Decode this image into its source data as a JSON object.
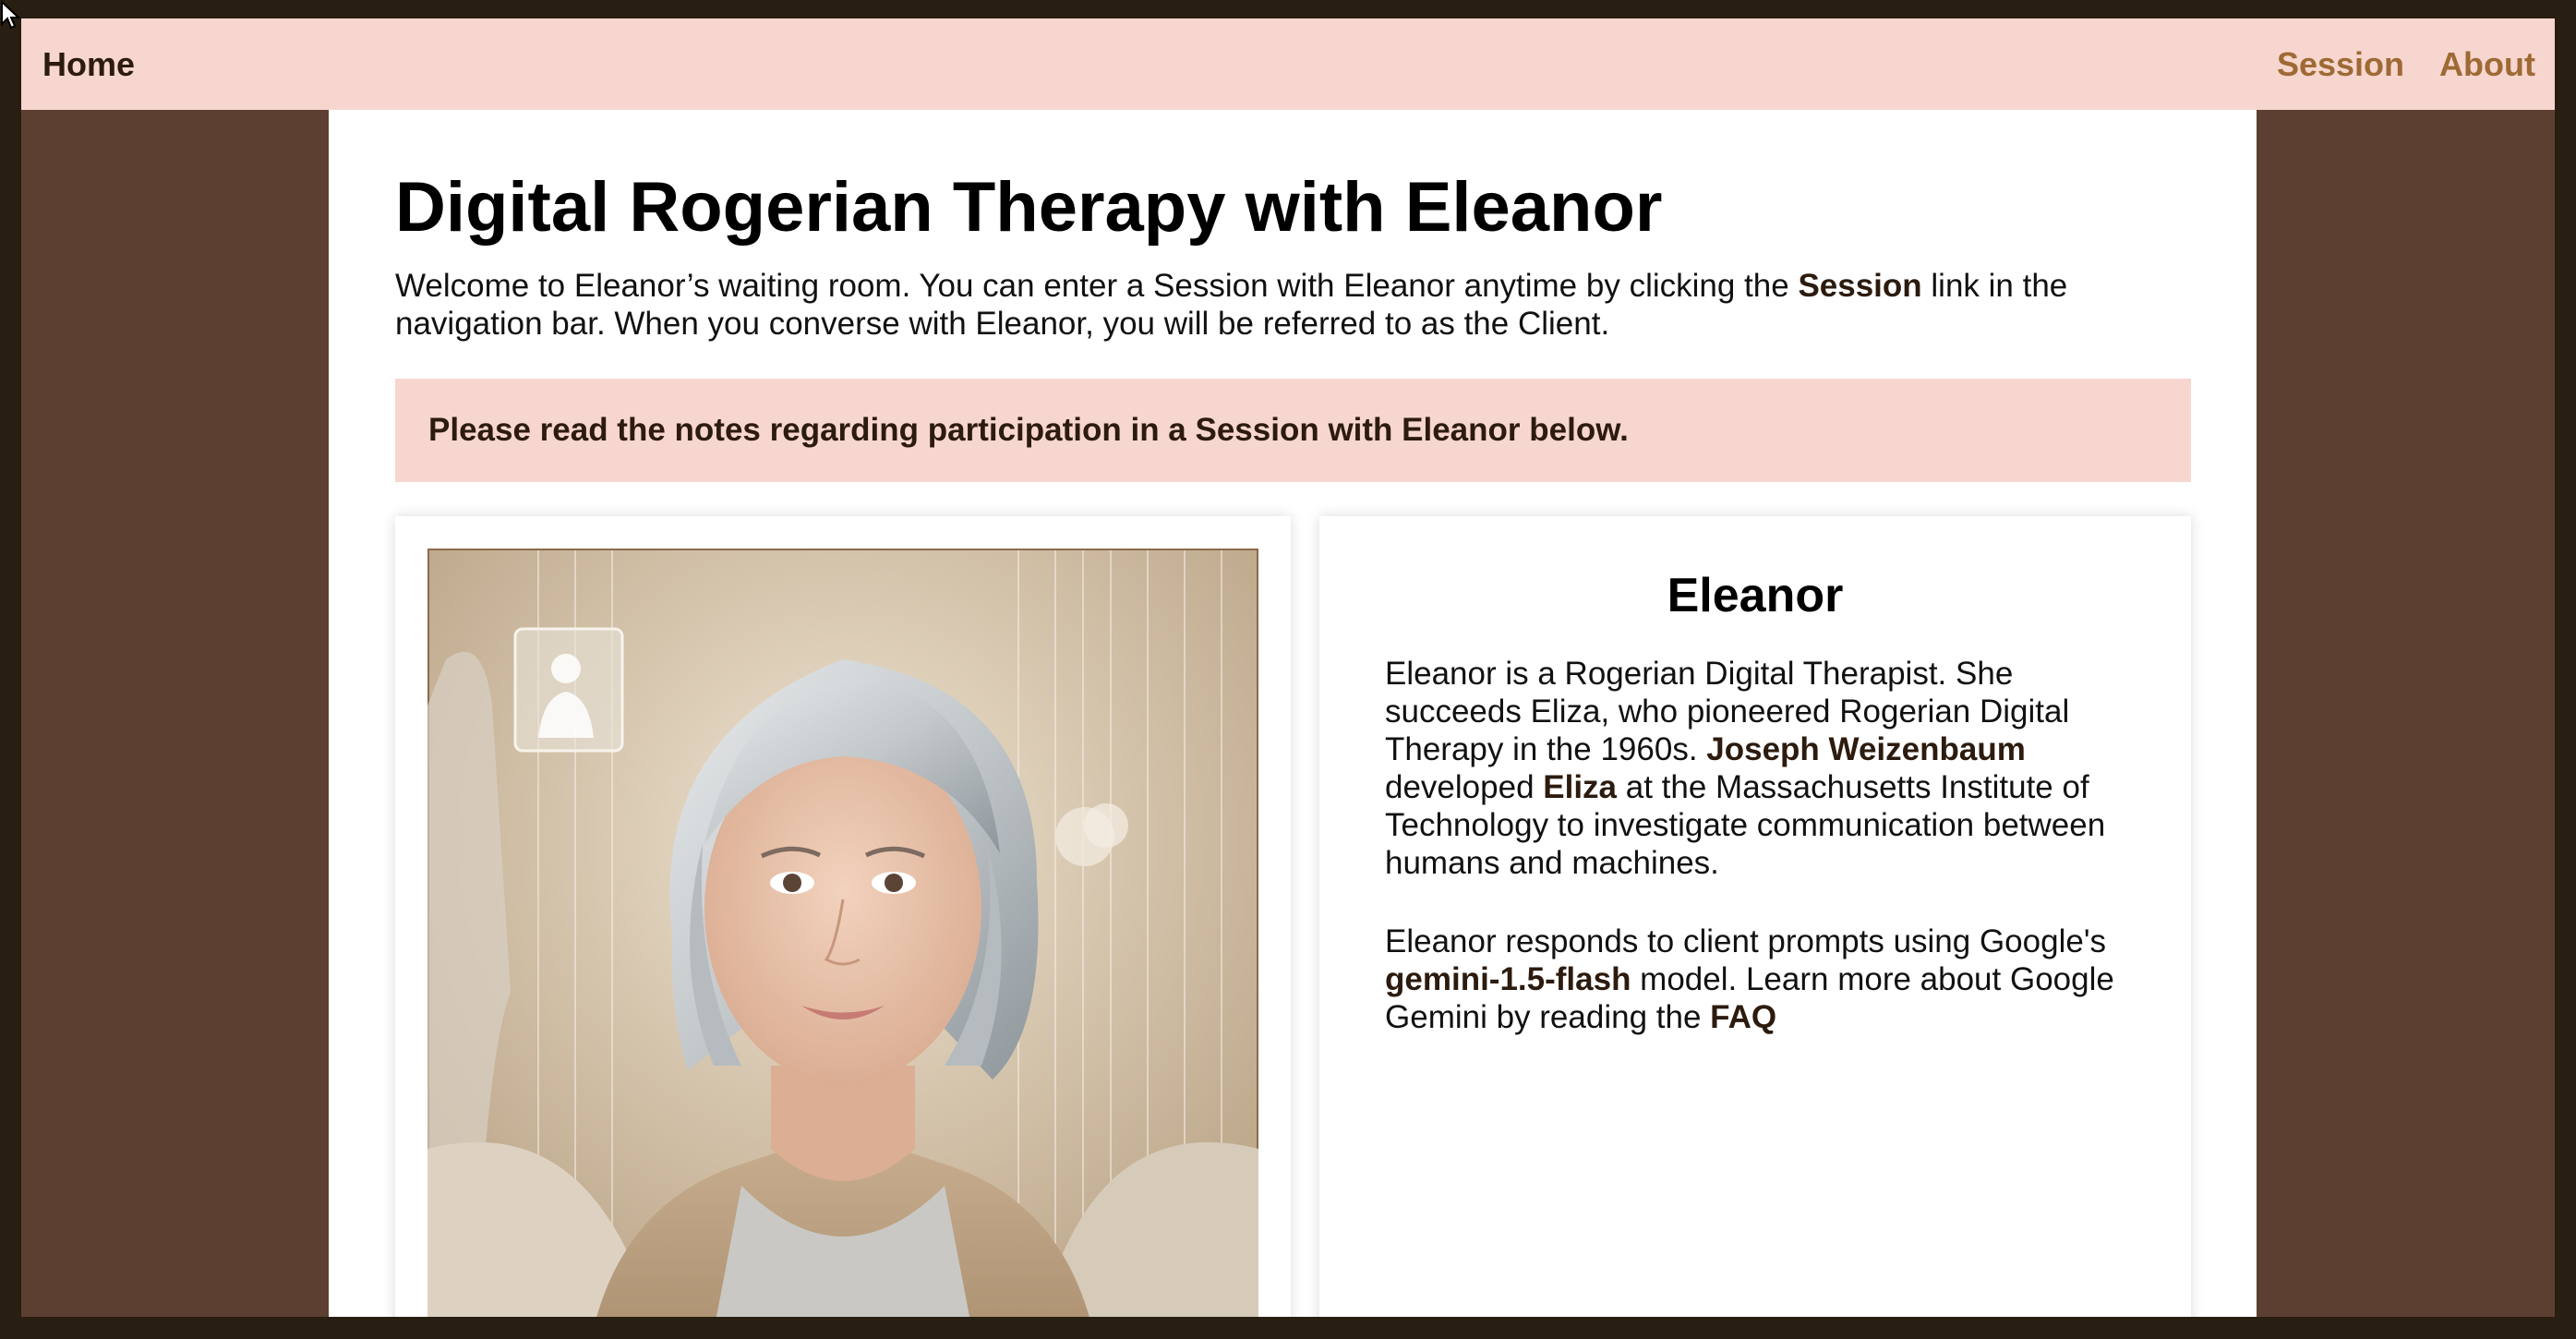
{
  "nav": {
    "home": "Home",
    "session": "Session",
    "about": "About"
  },
  "page": {
    "title": "Digital Rogerian Therapy with Eleanor",
    "intro": {
      "part1": "Welcome to Eleanor’s waiting room. You can enter a Session with Eleanor anytime by clicking the ",
      "session_word": "Session",
      "part2": " link in the navigation bar. When you converse with Eleanor, you will be referred to as the Client."
    },
    "notice": "Please read the notes regarding participation in a Session with Eleanor below."
  },
  "profile": {
    "heading": "Eleanor",
    "para1": {
      "t1": "Eleanor is a Rogerian Digital Therapist. She succeeds Eliza, who pioneered Rogerian Digital Therapy in the 1960s. ",
      "weizenbaum": "Joseph Weizenbaum",
      "t2": " developed ",
      "eliza": "Eliza",
      "t3": " at the Massachusetts Institute of Technology to investigate communication between humans and machines."
    },
    "para2": {
      "t1": "Eleanor responds to client prompts using Google's ",
      "model": "gemini-1.5-flash",
      "t2": " model. Learn more about Google Gemini by reading the ",
      "faq": "FAQ"
    }
  },
  "colors": {
    "frame": "#281e12",
    "background": "#5c3f31",
    "navbar": "#f7d6d0",
    "nav_link": "#9e6a34",
    "text_dark": "#2c1b0e"
  },
  "icons": {
    "cursor": "mouse-pointer-icon",
    "portrait": "eleanor-portrait-image"
  }
}
